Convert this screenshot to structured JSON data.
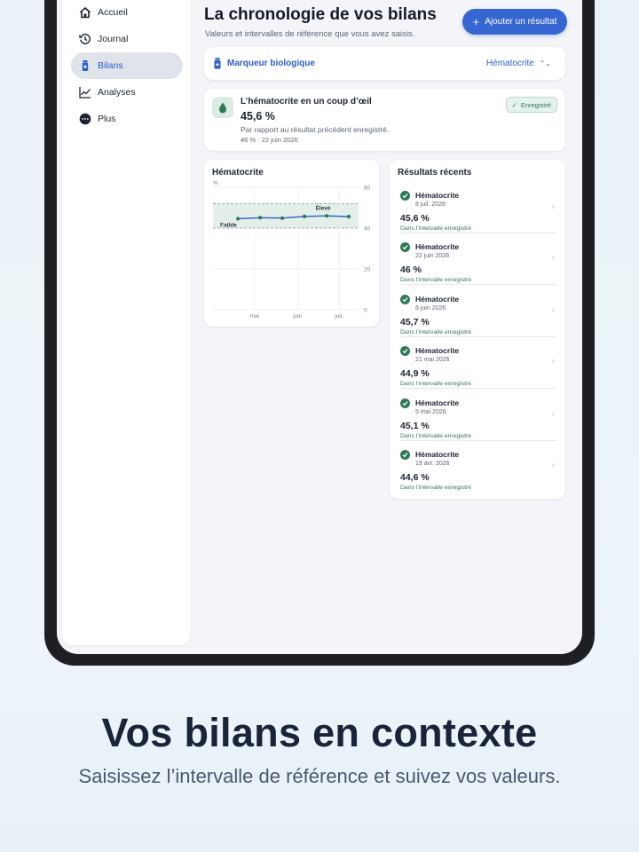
{
  "sidebar": {
    "items": [
      {
        "label": "Accueil",
        "icon": "home-icon",
        "active": false
      },
      {
        "label": "Journal",
        "icon": "history-icon",
        "active": false
      },
      {
        "label": "Bilans",
        "icon": "vial-icon",
        "active": true
      },
      {
        "label": "Analyses",
        "icon": "trend-icon",
        "active": false
      },
      {
        "label": "Plus",
        "icon": "more-icon",
        "active": false
      }
    ]
  },
  "header": {
    "title": "La chronologie de vos bilans",
    "subtitle": "Valeurs et intervalles de référence que vous avez saisis.",
    "add_button": "Ajouter un résultat"
  },
  "marker": {
    "label": "Marqueur biologique",
    "value": "Hématocrite"
  },
  "glance": {
    "title": "L’hématocrite en un coup d’œil",
    "value": "45,6 %",
    "description": "Par rapport au résultat précédent enregistré.",
    "previous": "46 % · 22 juin 2026",
    "badge": "Enregistré"
  },
  "chart_data": {
    "type": "line",
    "title": "Hématocrite",
    "ylabel": "%",
    "ylim": [
      0,
      60
    ],
    "yticks": [
      0,
      20,
      40,
      60
    ],
    "xticks": [
      "mai",
      "juin",
      "juil."
    ],
    "x": [
      "2026-04-19",
      "2026-05-05",
      "2026-05-21",
      "2026-06-06",
      "2026-06-22",
      "2026-07-08"
    ],
    "values": [
      44.6,
      45.1,
      44.9,
      45.7,
      46,
      45.6
    ],
    "reference_range": {
      "low": 40,
      "high": 52,
      "low_label": "Faible",
      "high_label": "Élevé"
    },
    "grid": true
  },
  "results": {
    "title": "Résultats récents",
    "items": [
      {
        "name": "Hématocrite",
        "date": "8 juil. 2026",
        "value": "45,6 %",
        "status": "Dans l’intervalle enregistré"
      },
      {
        "name": "Hématocrite",
        "date": "22 juin 2026",
        "value": "46 %",
        "status": "Dans l’intervalle enregistré"
      },
      {
        "name": "Hématocrite",
        "date": "6 juin 2026",
        "value": "45,7 %",
        "status": "Dans l’intervalle enregistré"
      },
      {
        "name": "Hématocrite",
        "date": "21 mai 2026",
        "value": "44,9 %",
        "status": "Dans l’intervalle enregistré"
      },
      {
        "name": "Hématocrite",
        "date": "5 mai 2026",
        "value": "45,1 %",
        "status": "Dans l’intervalle enregistré"
      },
      {
        "name": "Hématocrite",
        "date": "19 avr. 2026",
        "value": "44,6 %",
        "status": "Dans l’intervalle enregistré"
      }
    ]
  },
  "promo": {
    "headline": "Vos bilans en contexte",
    "tagline": "Saisissez l’intervalle de référence et suivez vos valeurs."
  },
  "colors": {
    "accent": "#3566d1",
    "success": "#2f7a56",
    "line": "#2d5ec9",
    "band": "#e3efe8"
  }
}
